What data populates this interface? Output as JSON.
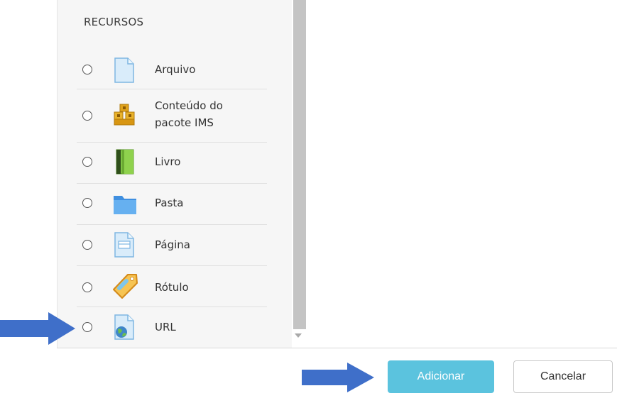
{
  "section": {
    "title": "RECURSOS"
  },
  "items": [
    {
      "label": "Arquivo",
      "icon": "file-icon"
    },
    {
      "label_line1": "Conteúdo do",
      "label_line2": "pacote IMS",
      "icon": "ims-package-icon"
    },
    {
      "label": "Livro",
      "icon": "book-icon"
    },
    {
      "label": "Pasta",
      "icon": "folder-icon"
    },
    {
      "label": "Página",
      "icon": "page-icon"
    },
    {
      "label": "Rótulo",
      "icon": "label-tag-icon"
    },
    {
      "label": "URL",
      "icon": "url-globe-icon"
    }
  ],
  "footer": {
    "add_label": "Adicionar",
    "cancel_label": "Cancelar"
  },
  "colors": {
    "add_button": "#5bc3de",
    "arrow": "#3f6fc9",
    "panel": "#f6f6f6"
  }
}
